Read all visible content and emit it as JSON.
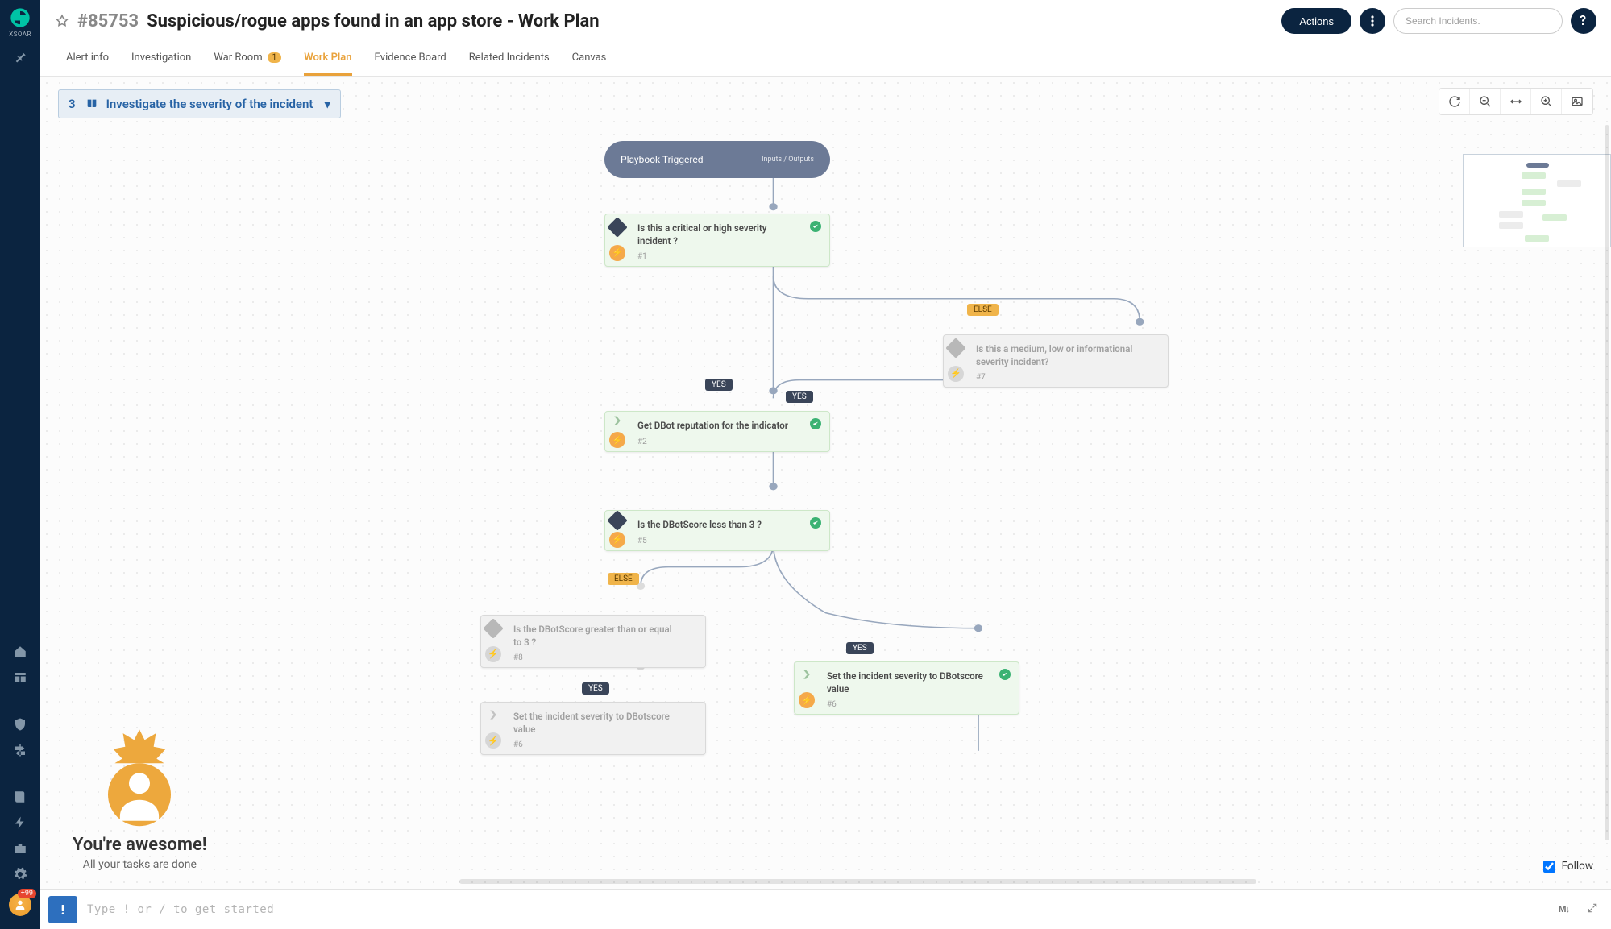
{
  "brand": {
    "name": "XSOAR"
  },
  "header": {
    "incident_id": "#85753",
    "title": "Suspicious/rogue apps found in an app store - Work Plan",
    "actions_label": "Actions",
    "search_placeholder": "Search Incidents."
  },
  "tabs": {
    "items": [
      {
        "label": "Alert info",
        "name": "tab-alert-info"
      },
      {
        "label": "Investigation",
        "name": "tab-investigation"
      },
      {
        "label": "War Room",
        "name": "tab-war-room",
        "badge": "1"
      },
      {
        "label": "Work Plan",
        "name": "tab-work-plan",
        "active": true
      },
      {
        "label": "Evidence Board",
        "name": "tab-evidence-board"
      },
      {
        "label": "Related Incidents",
        "name": "tab-related-incidents"
      },
      {
        "label": "Canvas",
        "name": "tab-canvas"
      }
    ]
  },
  "toolbar": {
    "count": "3",
    "breadcrumb_label": "Investigate the severity of the incident"
  },
  "playbook": {
    "trigger_label": "Playbook Triggered",
    "trigger_sub": "Inputs / Outputs",
    "tasks": {
      "t1": {
        "title": "Is this a critical or high severity incident ?",
        "num": "#1"
      },
      "t7": {
        "title": "Is this a medium, low or informational severity incident?",
        "num": "#7"
      },
      "t2": {
        "title": "Get DBot reputation for the indicator",
        "num": "#2"
      },
      "t5": {
        "title": "Is the DBotScore less than 3 ?",
        "num": "#5"
      },
      "t8": {
        "title": "Is the DBotScore greater than or equal to 3 ?",
        "num": "#8"
      },
      "t6a": {
        "title": "Set the incident severity to DBotscore value",
        "num": "#6"
      },
      "t6b": {
        "title": "Set the incident severity to DBotscore value",
        "num": "#6"
      }
    },
    "edge_labels": {
      "yes": "YES",
      "else": "ELSE"
    }
  },
  "congrats": {
    "big": "You're awesome!",
    "sub": "All your tasks are done"
  },
  "follow_label": "Follow",
  "cmdbar": {
    "placeholder": "Type ! or / to get started",
    "md_label": "M↓"
  },
  "avatar_badge": "+99"
}
